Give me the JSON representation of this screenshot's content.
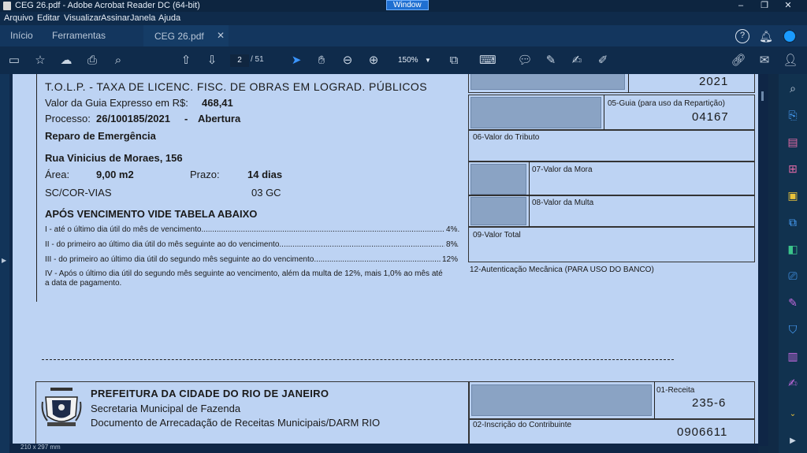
{
  "window": {
    "title": "CEG 26.pdf - Adobe Acrobat Reader DC (64-bit)",
    "badge": "Window",
    "controls": [
      "–",
      "❐",
      "✕"
    ]
  },
  "menu": [
    "Arquivo",
    "Editar",
    "Visualizar",
    "Assinar",
    "Janela",
    "Ajuda"
  ],
  "tabs": {
    "home": "Início",
    "tools": "Ferramentas",
    "document": "CEG 26.pdf",
    "document_close": "✕"
  },
  "toolbar": {
    "current_page": "2",
    "total_pages": "/ 51",
    "zoom": "150%",
    "icons": [
      "save-icon",
      "star-icon",
      "upload-icon",
      "print-icon",
      "search-zoom-icon",
      "prev-page-icon",
      "next-page-icon",
      "select-arrow-icon",
      "hand-icon",
      "zoom-out-icon",
      "zoom-in-icon",
      "fit-page-icon",
      "keyboard-icon",
      "comment-icon",
      "highlight-pen-icon",
      "sign-icon",
      "fill-sign-icon",
      "link-icon",
      "mail-icon",
      "add-user-icon"
    ]
  },
  "statusbar": {
    "page_size": "210 x 297 mm"
  },
  "document": {
    "tax_line": "T.O.L.P. - TAXA DE LICENC. FISC. DE OBRAS EM LOGRAD. PÚBLICOS",
    "guide_value_label": "Valor da Guia Expresso em R$:",
    "guide_value": "468,41",
    "process_label": "Processo:",
    "process_number": "26/100185/2021",
    "process_sep": "-",
    "process_status": "Abertura",
    "repair": "Reparo de Emergência",
    "address": "Rua Vinicius de Moraes, 156",
    "area_label": "Área:",
    "area_value": "9,00  m2",
    "term_label": "Prazo:",
    "term_value": "14  dias",
    "sc_cor": "SC/COR-VIAS",
    "gc": "03   GC",
    "after_due_title": "APÓS VENCIMENTO VIDE TABELA ABAIXO",
    "penalties": [
      {
        "text": "I - até o último dia útil do mês de vencimento",
        "rate": "4%"
      },
      {
        "text": "II - do primeiro ao último dia útil do mês seguinte ao do vencimento",
        "rate": "8%"
      },
      {
        "text": "III - do primeiro ao último dia útil do segundo mês seguinte ao do vencimento",
        "rate": "12%"
      }
    ],
    "penalty_iv_line1": "IV - Após o último dia útil do segundo mês seguinte ao vencimento, além da multa de 12%, mais 1,0% ao mês até",
    "penalty_iv_line2": "a data de pagamento.",
    "year": "2021",
    "guide_label": "05-Guia (para uso da  Repartição)",
    "guide_number": "04167",
    "tribute_label": "06-Valor do Tributo",
    "mora_label": "07-Valor da Mora",
    "fine_label": "08-Valor da Multa",
    "total_label": "09-Valor Total",
    "auth_label": "12-Autenticação Mecânica (PARA USO DO BANCO)",
    "city_hall": "PREFEITURA DA CIDADE DO RIO DE JANEIRO",
    "secretariat": "Secretaria Municipal de Fazenda",
    "darm": "Documento de Arrecadação de Receitas Municipais/DARM RIO",
    "revenue_label": "01-Receita",
    "revenue_code": "235-6",
    "taxpayer_label": "02-Inscrição do Contribuinte",
    "taxpayer_number": "0906611"
  }
}
